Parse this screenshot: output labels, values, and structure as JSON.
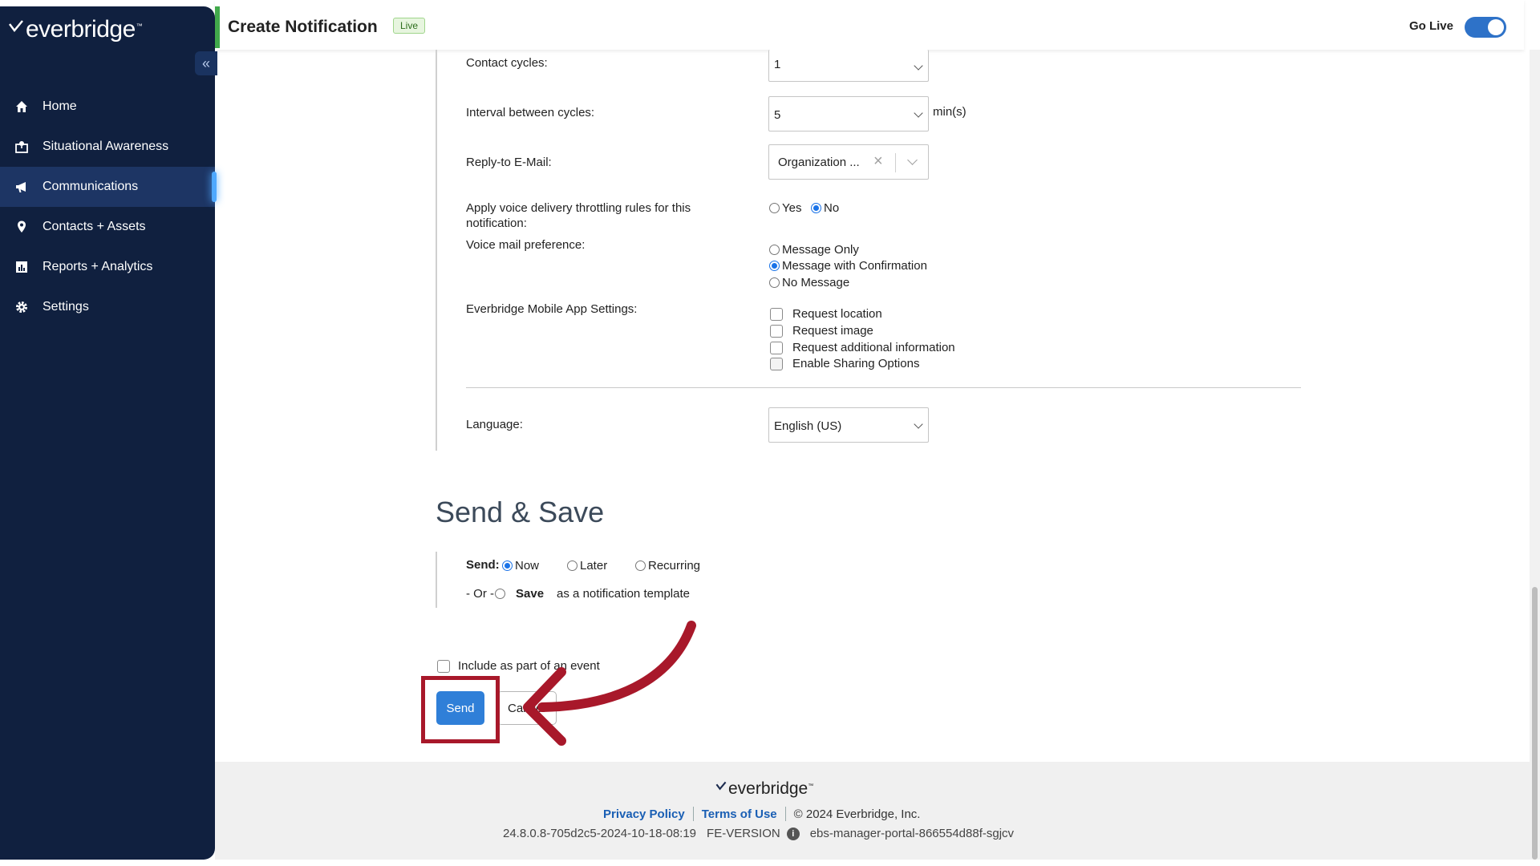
{
  "app": {
    "brand": "everbridge"
  },
  "sidebar": {
    "items": [
      {
        "label": "Home",
        "icon": "home-icon"
      },
      {
        "label": "Situational Awareness",
        "icon": "map-icon"
      },
      {
        "label": "Communications",
        "icon": "megaphone-icon",
        "active": true
      },
      {
        "label": "Contacts + Assets",
        "icon": "location-pin-icon"
      },
      {
        "label": "Reports + Analytics",
        "icon": "bar-chart-icon"
      },
      {
        "label": "Settings",
        "icon": "gear-icon"
      }
    ]
  },
  "header": {
    "title": "Create Notification",
    "badge": "Live",
    "go_live_label": "Go Live",
    "go_live_on": true
  },
  "form": {
    "contact_cycles": {
      "label": "Contact cycles:",
      "value": "1"
    },
    "interval": {
      "label": "Interval between cycles:",
      "value": "5",
      "unit": "min(s)"
    },
    "reply_to": {
      "label": "Reply-to E-Mail:",
      "value": "Organization ..."
    },
    "throttle": {
      "label": "Apply voice delivery throttling rules for this notification:",
      "options": [
        "Yes",
        "No"
      ],
      "selected": "No"
    },
    "voicemail": {
      "label": "Voice mail preference:",
      "options": [
        "Message Only",
        "Message with Confirmation",
        "No Message"
      ],
      "selected": "Message with Confirmation"
    },
    "mobile": {
      "label": "Everbridge Mobile App Settings:",
      "options": [
        "Request location",
        "Request image",
        "Request additional information",
        "Enable Sharing Options"
      ]
    },
    "language": {
      "label": "Language:",
      "value": "English (US)"
    }
  },
  "send_save": {
    "title": "Send & Save",
    "send_label": "Send:",
    "send_options": [
      "Now",
      "Later",
      "Recurring"
    ],
    "send_selected": "Now",
    "or_label": "- Or -",
    "save_label": "Save",
    "save_suffix": "as a notification template",
    "include_event": "Include as part of an event",
    "send_button": "Send",
    "cancel_button": "Cancel"
  },
  "footer": {
    "brand": "everbridge",
    "privacy": "Privacy Policy",
    "terms": "Terms of Use",
    "copyright": "© 2024 Everbridge, Inc.",
    "build": "24.8.0.8-705d2c5-2024-10-18-08:19",
    "fe_version": "FE-VERSION",
    "instance": "ebs-manager-portal-866554d88f-sgjcv"
  },
  "colors": {
    "sidebar_bg": "#10203f",
    "accent": "#2f7fd8",
    "annotation": "#a8182a",
    "live_green": "#41a94b"
  }
}
